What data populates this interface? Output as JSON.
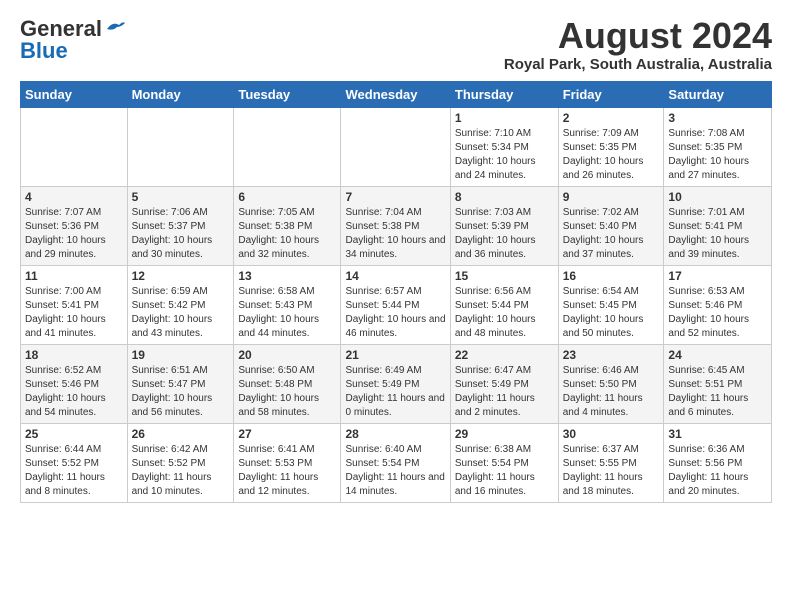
{
  "header": {
    "logo_general": "General",
    "logo_blue": "Blue",
    "month_title": "August 2024",
    "location": "Royal Park, South Australia, Australia"
  },
  "weekdays": [
    "Sunday",
    "Monday",
    "Tuesday",
    "Wednesday",
    "Thursday",
    "Friday",
    "Saturday"
  ],
  "weeks": [
    [
      {
        "day": "",
        "sunrise": "",
        "sunset": "",
        "daylight": ""
      },
      {
        "day": "",
        "sunrise": "",
        "sunset": "",
        "daylight": ""
      },
      {
        "day": "",
        "sunrise": "",
        "sunset": "",
        "daylight": ""
      },
      {
        "day": "",
        "sunrise": "",
        "sunset": "",
        "daylight": ""
      },
      {
        "day": "1",
        "sunrise": "Sunrise: 7:10 AM",
        "sunset": "Sunset: 5:34 PM",
        "daylight": "Daylight: 10 hours and 24 minutes."
      },
      {
        "day": "2",
        "sunrise": "Sunrise: 7:09 AM",
        "sunset": "Sunset: 5:35 PM",
        "daylight": "Daylight: 10 hours and 26 minutes."
      },
      {
        "day": "3",
        "sunrise": "Sunrise: 7:08 AM",
        "sunset": "Sunset: 5:35 PM",
        "daylight": "Daylight: 10 hours and 27 minutes."
      }
    ],
    [
      {
        "day": "4",
        "sunrise": "Sunrise: 7:07 AM",
        "sunset": "Sunset: 5:36 PM",
        "daylight": "Daylight: 10 hours and 29 minutes."
      },
      {
        "day": "5",
        "sunrise": "Sunrise: 7:06 AM",
        "sunset": "Sunset: 5:37 PM",
        "daylight": "Daylight: 10 hours and 30 minutes."
      },
      {
        "day": "6",
        "sunrise": "Sunrise: 7:05 AM",
        "sunset": "Sunset: 5:38 PM",
        "daylight": "Daylight: 10 hours and 32 minutes."
      },
      {
        "day": "7",
        "sunrise": "Sunrise: 7:04 AM",
        "sunset": "Sunset: 5:38 PM",
        "daylight": "Daylight: 10 hours and 34 minutes."
      },
      {
        "day": "8",
        "sunrise": "Sunrise: 7:03 AM",
        "sunset": "Sunset: 5:39 PM",
        "daylight": "Daylight: 10 hours and 36 minutes."
      },
      {
        "day": "9",
        "sunrise": "Sunrise: 7:02 AM",
        "sunset": "Sunset: 5:40 PM",
        "daylight": "Daylight: 10 hours and 37 minutes."
      },
      {
        "day": "10",
        "sunrise": "Sunrise: 7:01 AM",
        "sunset": "Sunset: 5:41 PM",
        "daylight": "Daylight: 10 hours and 39 minutes."
      }
    ],
    [
      {
        "day": "11",
        "sunrise": "Sunrise: 7:00 AM",
        "sunset": "Sunset: 5:41 PM",
        "daylight": "Daylight: 10 hours and 41 minutes."
      },
      {
        "day": "12",
        "sunrise": "Sunrise: 6:59 AM",
        "sunset": "Sunset: 5:42 PM",
        "daylight": "Daylight: 10 hours and 43 minutes."
      },
      {
        "day": "13",
        "sunrise": "Sunrise: 6:58 AM",
        "sunset": "Sunset: 5:43 PM",
        "daylight": "Daylight: 10 hours and 44 minutes."
      },
      {
        "day": "14",
        "sunrise": "Sunrise: 6:57 AM",
        "sunset": "Sunset: 5:44 PM",
        "daylight": "Daylight: 10 hours and 46 minutes."
      },
      {
        "day": "15",
        "sunrise": "Sunrise: 6:56 AM",
        "sunset": "Sunset: 5:44 PM",
        "daylight": "Daylight: 10 hours and 48 minutes."
      },
      {
        "day": "16",
        "sunrise": "Sunrise: 6:54 AM",
        "sunset": "Sunset: 5:45 PM",
        "daylight": "Daylight: 10 hours and 50 minutes."
      },
      {
        "day": "17",
        "sunrise": "Sunrise: 6:53 AM",
        "sunset": "Sunset: 5:46 PM",
        "daylight": "Daylight: 10 hours and 52 minutes."
      }
    ],
    [
      {
        "day": "18",
        "sunrise": "Sunrise: 6:52 AM",
        "sunset": "Sunset: 5:46 PM",
        "daylight": "Daylight: 10 hours and 54 minutes."
      },
      {
        "day": "19",
        "sunrise": "Sunrise: 6:51 AM",
        "sunset": "Sunset: 5:47 PM",
        "daylight": "Daylight: 10 hours and 56 minutes."
      },
      {
        "day": "20",
        "sunrise": "Sunrise: 6:50 AM",
        "sunset": "Sunset: 5:48 PM",
        "daylight": "Daylight: 10 hours and 58 minutes."
      },
      {
        "day": "21",
        "sunrise": "Sunrise: 6:49 AM",
        "sunset": "Sunset: 5:49 PM",
        "daylight": "Daylight: 11 hours and 0 minutes."
      },
      {
        "day": "22",
        "sunrise": "Sunrise: 6:47 AM",
        "sunset": "Sunset: 5:49 PM",
        "daylight": "Daylight: 11 hours and 2 minutes."
      },
      {
        "day": "23",
        "sunrise": "Sunrise: 6:46 AM",
        "sunset": "Sunset: 5:50 PM",
        "daylight": "Daylight: 11 hours and 4 minutes."
      },
      {
        "day": "24",
        "sunrise": "Sunrise: 6:45 AM",
        "sunset": "Sunset: 5:51 PM",
        "daylight": "Daylight: 11 hours and 6 minutes."
      }
    ],
    [
      {
        "day": "25",
        "sunrise": "Sunrise: 6:44 AM",
        "sunset": "Sunset: 5:52 PM",
        "daylight": "Daylight: 11 hours and 8 minutes."
      },
      {
        "day": "26",
        "sunrise": "Sunrise: 6:42 AM",
        "sunset": "Sunset: 5:52 PM",
        "daylight": "Daylight: 11 hours and 10 minutes."
      },
      {
        "day": "27",
        "sunrise": "Sunrise: 6:41 AM",
        "sunset": "Sunset: 5:53 PM",
        "daylight": "Daylight: 11 hours and 12 minutes."
      },
      {
        "day": "28",
        "sunrise": "Sunrise: 6:40 AM",
        "sunset": "Sunset: 5:54 PM",
        "daylight": "Daylight: 11 hours and 14 minutes."
      },
      {
        "day": "29",
        "sunrise": "Sunrise: 6:38 AM",
        "sunset": "Sunset: 5:54 PM",
        "daylight": "Daylight: 11 hours and 16 minutes."
      },
      {
        "day": "30",
        "sunrise": "Sunrise: 6:37 AM",
        "sunset": "Sunset: 5:55 PM",
        "daylight": "Daylight: 11 hours and 18 minutes."
      },
      {
        "day": "31",
        "sunrise": "Sunrise: 6:36 AM",
        "sunset": "Sunset: 5:56 PM",
        "daylight": "Daylight: 11 hours and 20 minutes."
      }
    ]
  ]
}
